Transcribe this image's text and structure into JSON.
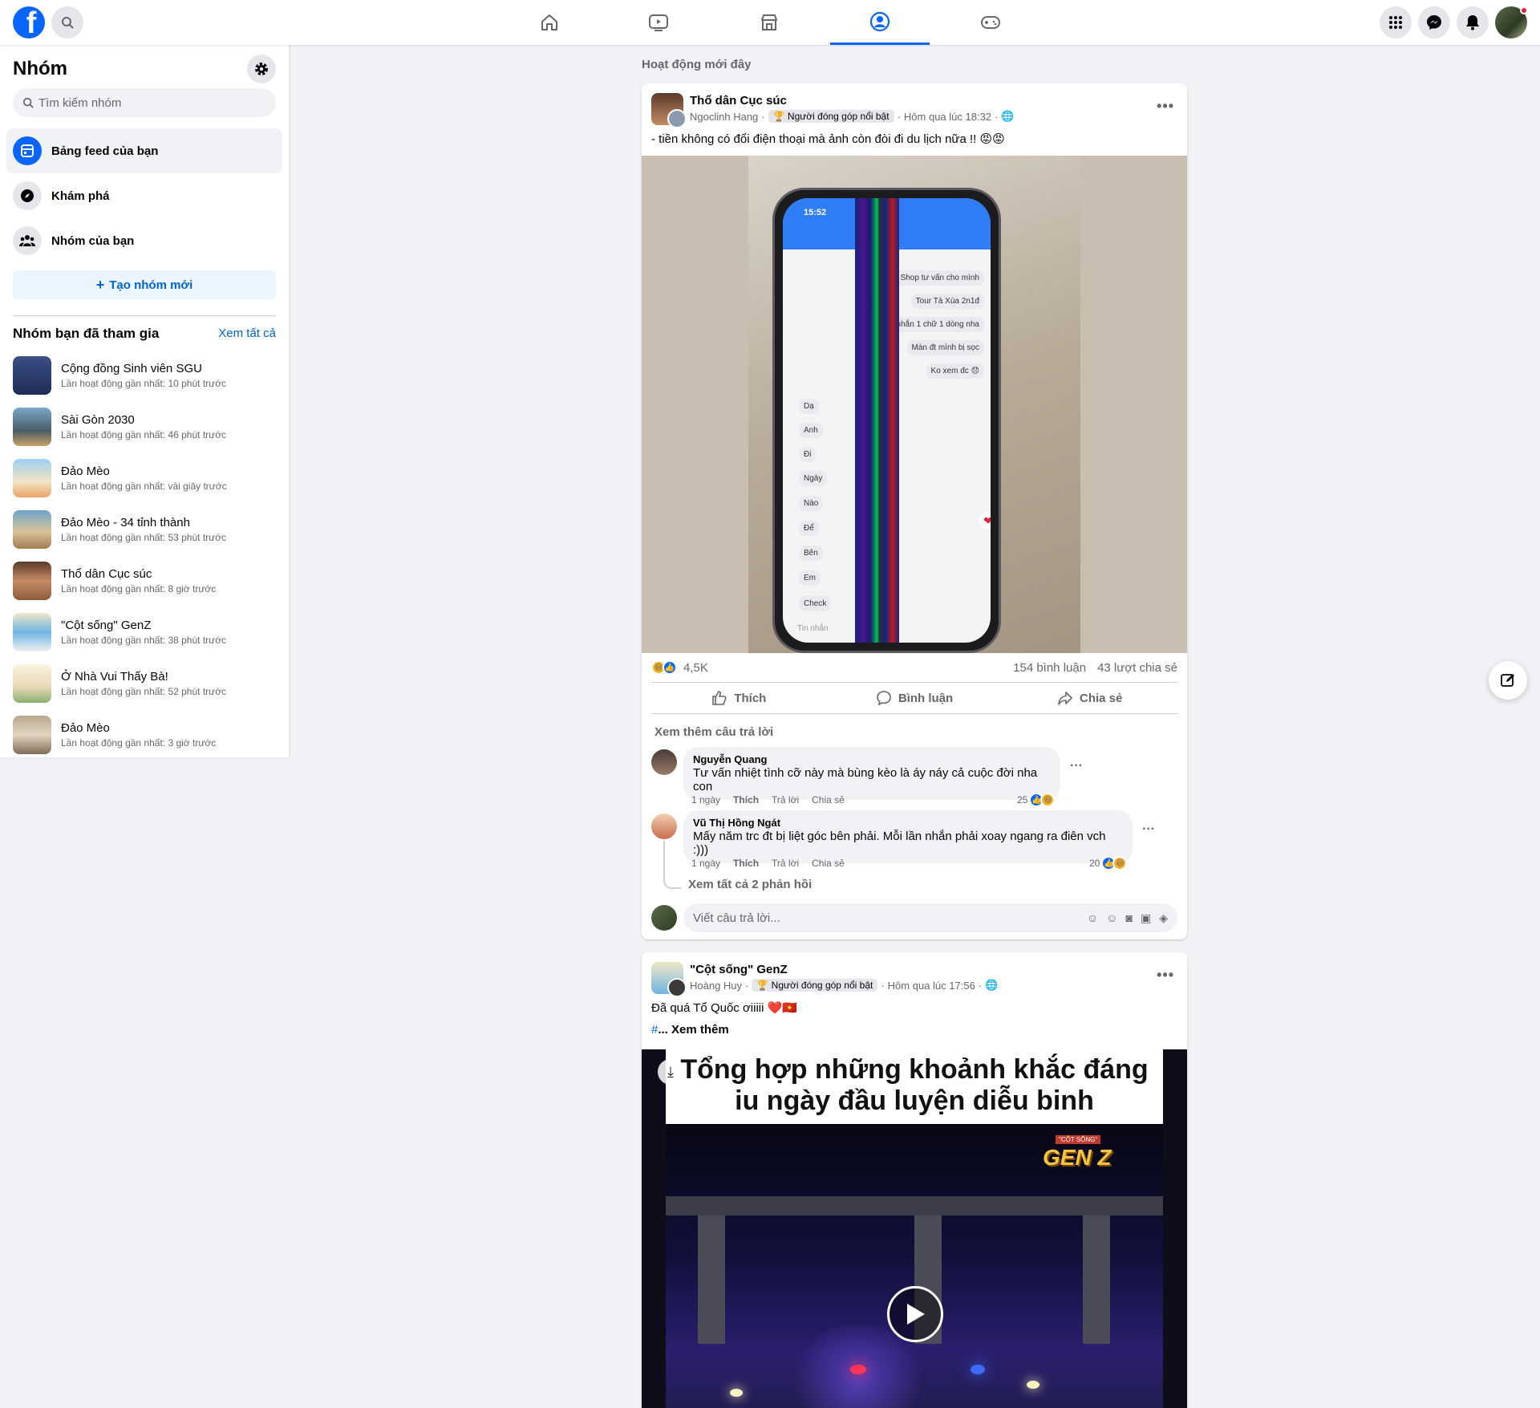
{
  "nav": {
    "tabs": [
      {
        "icon": "home-icon"
      },
      {
        "icon": "video-icon"
      },
      {
        "icon": "marketplace-icon"
      },
      {
        "icon": "groups-icon",
        "active": true
      },
      {
        "icon": "gaming-icon"
      }
    ],
    "right_icons": [
      "menu-grid-icon",
      "messenger-icon",
      "notifications-icon",
      "profile-avatar"
    ],
    "accent_color": "#0866ff"
  },
  "sidebar": {
    "title": "Nhóm",
    "search_placeholder": "Tìm kiếm nhóm",
    "items": [
      {
        "label": "Bảng feed của bạn",
        "icon": "feed-icon",
        "active": true
      },
      {
        "label": "Khám phá",
        "icon": "compass-icon"
      },
      {
        "label": "Nhóm của bạn",
        "icon": "people-icon"
      }
    ],
    "create_label": "Tạo nhóm mới",
    "joined_title": "Nhóm bạn đã tham gia",
    "see_all": "Xem tất cả",
    "groups": [
      {
        "name": "Cộng đồng Sinh viên SGU",
        "meta": "Lần hoạt động gần nhất: 10 phút trước"
      },
      {
        "name": "Sài Gòn 2030",
        "meta": "Lần hoạt động gần nhất: 46 phút trước"
      },
      {
        "name": "Đảo Mèo",
        "meta": "Lần hoạt động gần nhất: vài giây trước"
      },
      {
        "name": "Đảo Mèo - 34 tỉnh thành",
        "meta": "Lần hoạt động gần nhất: 53 phút trước"
      },
      {
        "name": "Thổ dân Cục súc",
        "meta": "Lần hoạt động gần nhất: 8 giờ trước"
      },
      {
        "name": "\"Cột sống\" GenZ",
        "meta": "Lần hoạt động gần nhất: 38 phút trước"
      },
      {
        "name": "Ở Nhà Vui Thấy Bà!",
        "meta": "Lần hoạt động gần nhất: 52 phút trước"
      },
      {
        "name": "Đảo Mèo",
        "meta": "Lần hoạt động gần nhất: 3 giờ trước"
      }
    ]
  },
  "feed": {
    "heading": "Hoạt động mới đây",
    "post1": {
      "group": "Thổ dân Cục súc",
      "author": "Ngoclinh Hang",
      "badge": "Người đóng góp nổi bật",
      "time": "Hôm qua lúc 18:32",
      "text": "- tiền không có đổi điện thoại mà ảnh còn đòi đi du lịch nữa !! 😡😡",
      "phone": {
        "clock": "15:52",
        "messages_right": [
          "Shop tư vấn cho mình",
          "Tour Tà Xùa 2n1đ",
          "nhắn 1 chữ 1 dòng nha",
          "Màn đt mình bị sọc",
          "Ko xem đc 😞"
        ],
        "messages_left": [
          "Dạ",
          "Anh",
          "Đi",
          "Ngày",
          "Nào",
          "Để",
          "Bên",
          "Em",
          "Check"
        ],
        "input_placeholder": "Tin nhắn"
      },
      "reactions_count": "4,5K",
      "comments_count": "154 bình luận",
      "shares_count": "43 lượt chia sẻ",
      "actions": {
        "like": "Thích",
        "comment": "Bình luận",
        "share": "Chia sẻ"
      },
      "more_replies": "Xem thêm câu trả lời",
      "comments": [
        {
          "name": "Nguyễn Quang",
          "text": "Tư vấn nhiệt tình cỡ này mà bùng kèo là áy náy cả cuộc đời nha con",
          "time": "1 ngày",
          "like": "Thích",
          "reply": "Trả lời",
          "share": "Chia sẻ",
          "reacts": "25"
        },
        {
          "name": "Vũ Thị Hồng Ngát",
          "text": "Mấy năm trc đt bị liệt góc bên phải. Mỗi lần nhắn phải xoay ngang ra điên vch :)))",
          "time": "1 ngày",
          "like": "Thích",
          "reply": "Trả lời",
          "share": "Chia sẻ",
          "reacts": "20"
        }
      ],
      "see_replies": "Xem tất cả 2 phản hồi",
      "reply_placeholder": "Viết câu trả lời..."
    },
    "post2": {
      "group": "\"Cột sống\" GenZ",
      "author": "Hoàng Huy",
      "badge": "Người đóng góp nổi bật",
      "time": "Hôm qua lúc 17:56",
      "text": "Đã quá Tổ Quốc ơiiiii ❤️🇻🇳",
      "hashtag": "#",
      "see_more": "... Xem thêm",
      "video_title": "Tổng hợp những khoảnh khắc đáng iu ngày đầu luyện diễu binh",
      "video_logo_small": "\"CỘT SỐNG\"",
      "video_logo": "GEN Z"
    }
  }
}
